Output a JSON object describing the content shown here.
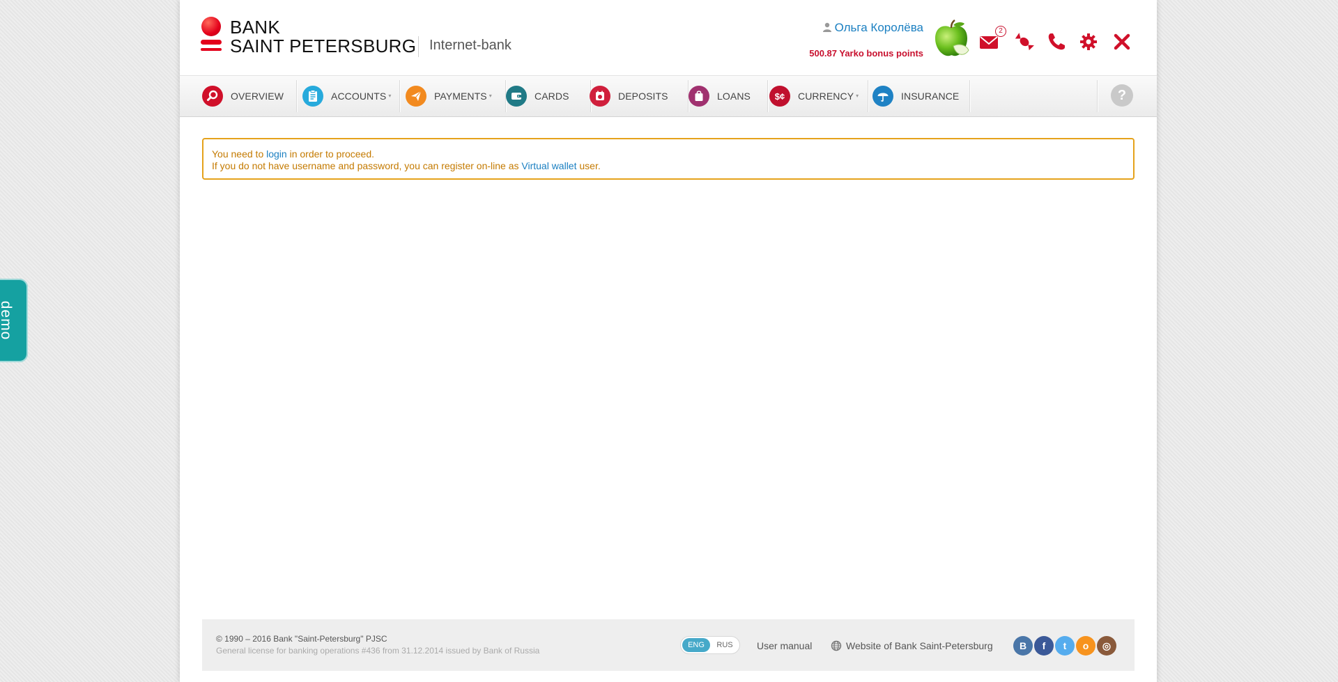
{
  "logo": {
    "line1": "BANK",
    "line2": "SAINT PETERSBURG",
    "subtitle": "Internet-bank"
  },
  "user": {
    "name": "Ольга Королёва",
    "bonus": "500.87 Yarko bonus points",
    "mail_badge": "2"
  },
  "nav": {
    "items": [
      {
        "label": "OVERVIEW",
        "icon": "search-icon",
        "color": "#d0102a",
        "dropdown": false
      },
      {
        "label": "ACCOUNTS",
        "icon": "clipboard-icon",
        "color": "#27aadc",
        "dropdown": true
      },
      {
        "label": "PAYMENTS",
        "icon": "paper-plane-icon",
        "color": "#f28a1f",
        "dropdown": true
      },
      {
        "label": "CARDS",
        "icon": "wallet-icon",
        "color": "#207a86",
        "dropdown": false
      },
      {
        "label": "DEPOSITS",
        "icon": "piggy-bank-icon",
        "color": "#d01f3c",
        "dropdown": false
      },
      {
        "label": "LOANS",
        "icon": "shopping-bag-icon",
        "color": "#a0316f",
        "dropdown": false
      },
      {
        "label": "CURRENCY",
        "icon": "currency-icon",
        "color": "#c0102e",
        "dropdown": true
      },
      {
        "label": "INSURANCE",
        "icon": "umbrella-icon",
        "color": "#1f82c4",
        "dropdown": false
      }
    ],
    "help": "?"
  },
  "message": {
    "line1_before": "You need to ",
    "line1_link": "login",
    "line1_after": " in order to proceed.",
    "line2_before": "If you do not have username and password, you can register on-line as ",
    "line2_link": "Virtual wallet",
    "line2_after": " user."
  },
  "footer": {
    "copyright": "© 1990 – 2016 Bank \"Saint-Petersburg\" PJSC",
    "license": "General license for banking operations #436 from 31.12.2014 issued by Bank of Russia",
    "lang_eng": "ENG",
    "lang_rus": "RUS",
    "manual": "User manual",
    "website": "Website of Bank Saint-Petersburg",
    "social": [
      {
        "name": "vk-icon",
        "glyph": "B",
        "color": "#4a76a8"
      },
      {
        "name": "facebook-icon",
        "glyph": "f",
        "color": "#3b5998"
      },
      {
        "name": "twitter-icon",
        "glyph": "t",
        "color": "#55acee"
      },
      {
        "name": "odnoklassniki-icon",
        "glyph": "o",
        "color": "#f7931e"
      },
      {
        "name": "instagram-icon",
        "glyph": "◎",
        "color": "#8a5a3b"
      }
    ]
  },
  "demo_tab": "demo"
}
